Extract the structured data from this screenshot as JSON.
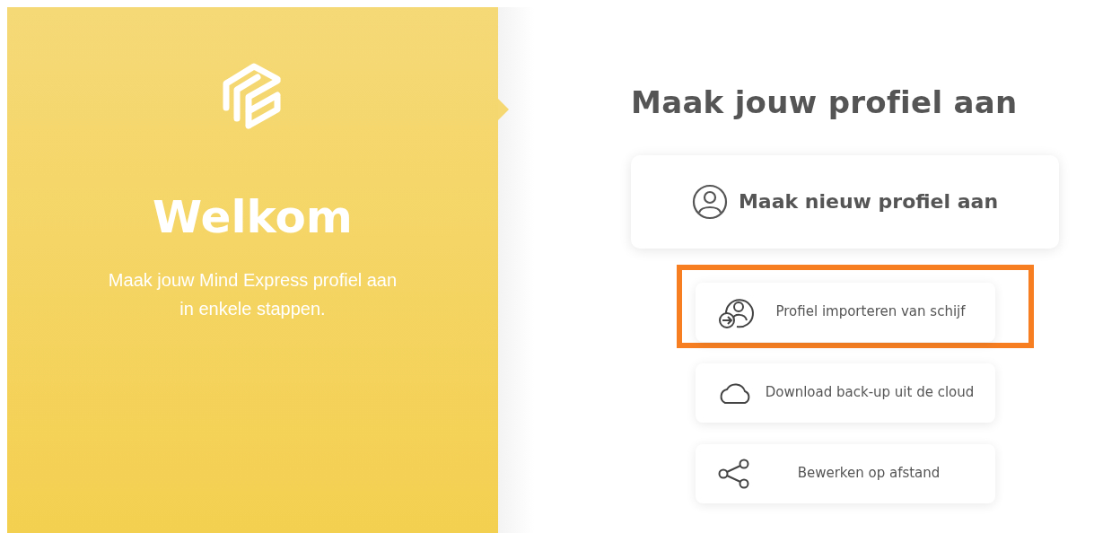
{
  "welcome_panel": {
    "title": "Welkom",
    "subtitle": "Maak jouw Mind Express profiel aan in enkele stappen."
  },
  "heading": "Maak jouw profiel aan",
  "primary_action": {
    "label": "Maak nieuw profiel aan",
    "kind": "profile"
  },
  "options": [
    {
      "label": "Profiel importeren van schijf",
      "kind": "import",
      "highlighted": true
    },
    {
      "label": "Download back-up uit de cloud",
      "kind": "cloud",
      "highlighted": false
    },
    {
      "label": "Bewerken op afstand",
      "kind": "share",
      "highlighted": false
    }
  ]
}
